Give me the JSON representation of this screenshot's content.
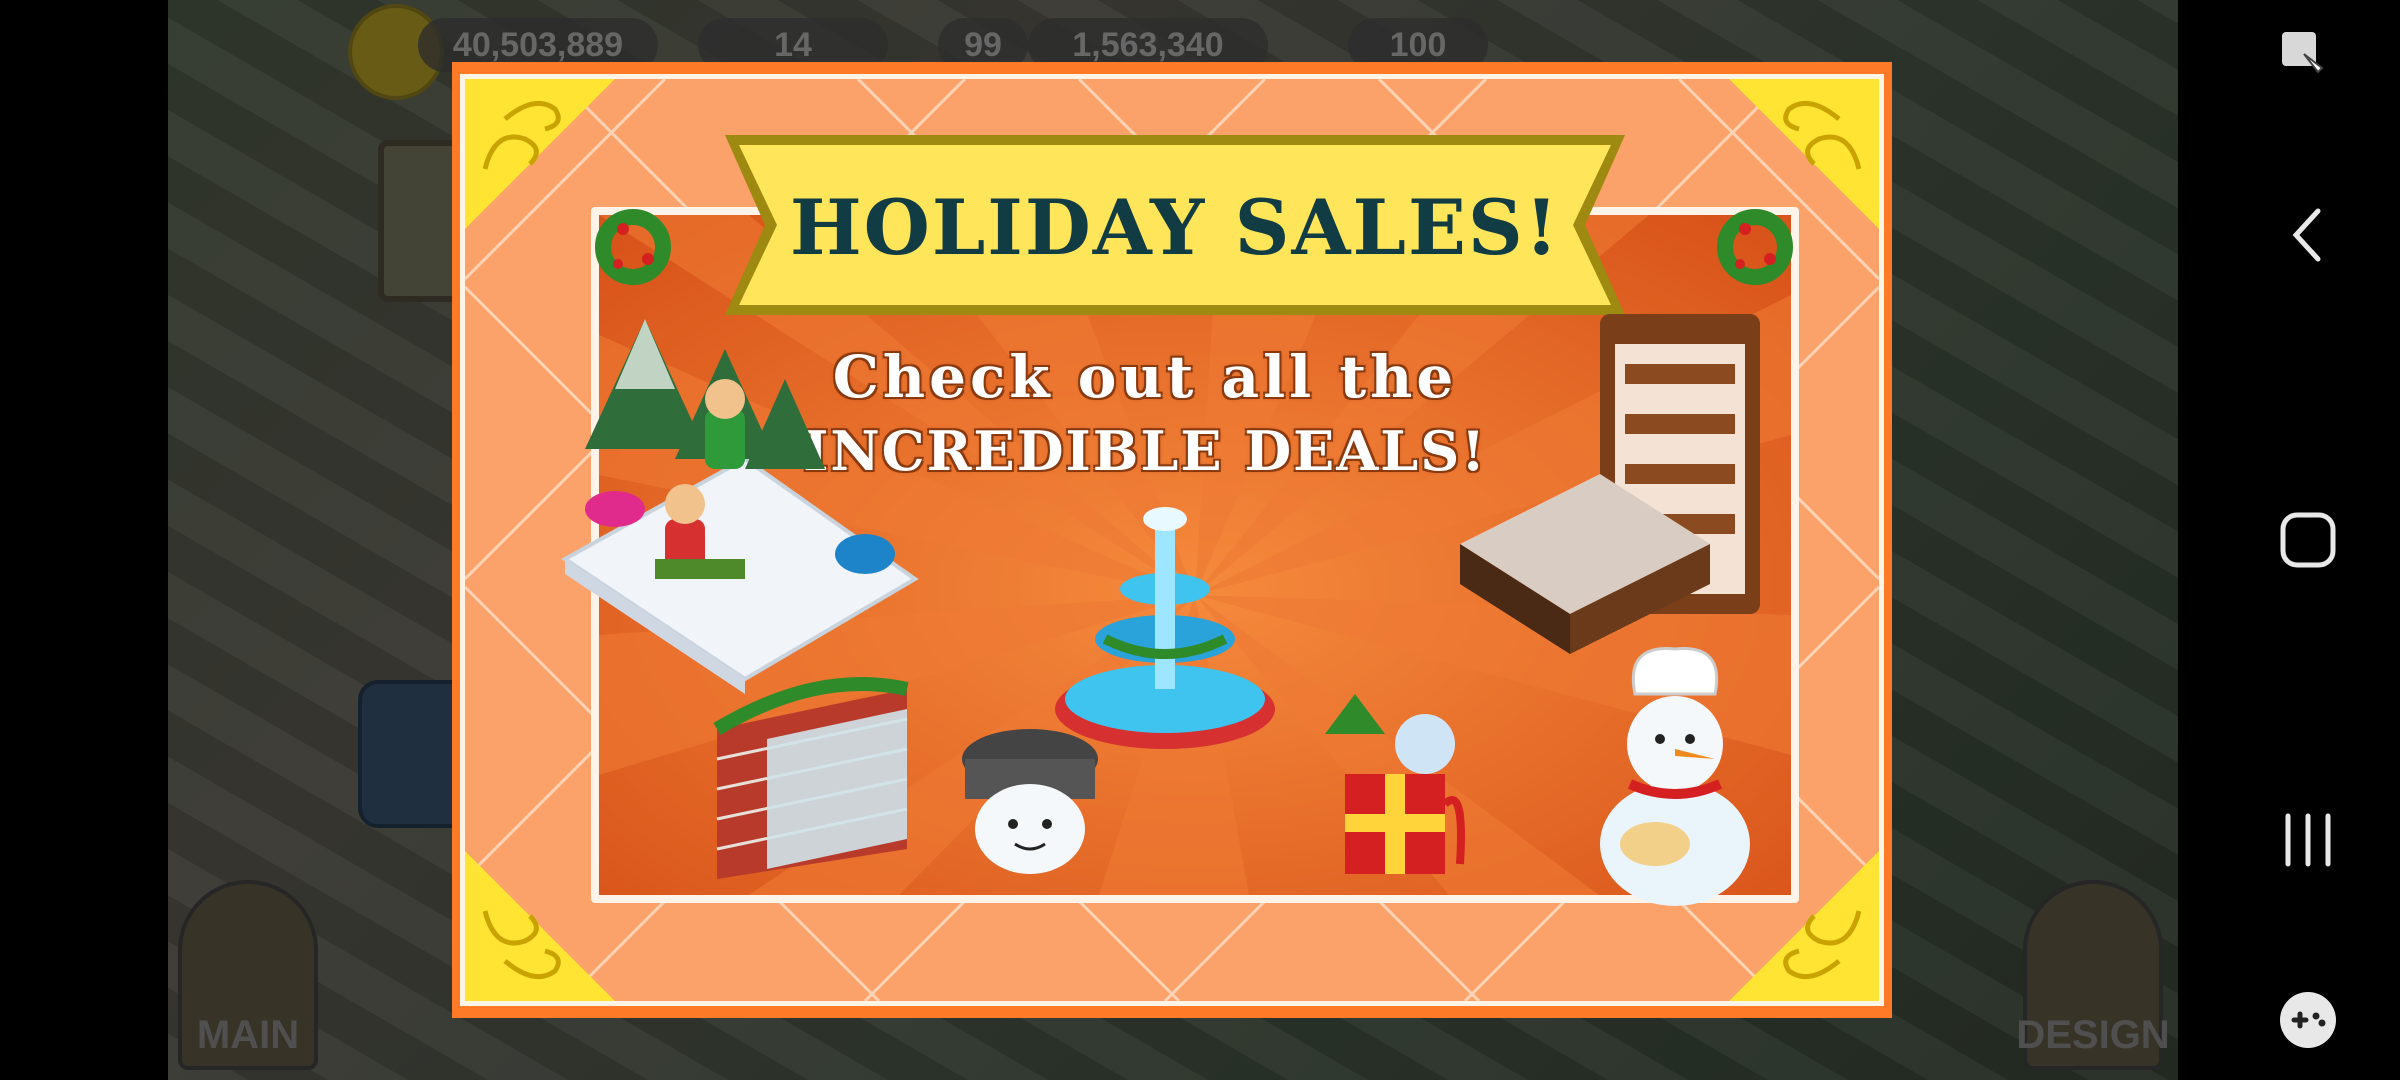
{
  "hud": {
    "coins": "40,503,889",
    "level": "14",
    "gems_prefix": "99",
    "gems": "1,563,340",
    "hearts": "100"
  },
  "game_buttons": {
    "main_label": "MAIN",
    "design_label": "DESIGN"
  },
  "popup": {
    "title": "HOLIDAY SALES!",
    "subtitle_line1": "Check out all the",
    "subtitle_line2": "INCREDIBLE DEALS!"
  },
  "colors": {
    "popup_orange": "#ff7a26",
    "banner_yellow": "#ffe55a",
    "title_teal": "#123c44",
    "corner_yellow": "#ffe433"
  },
  "nav_icons": [
    "screenshot-editor-icon",
    "back-icon",
    "home-icon",
    "recents-icon",
    "game-tools-icon"
  ]
}
